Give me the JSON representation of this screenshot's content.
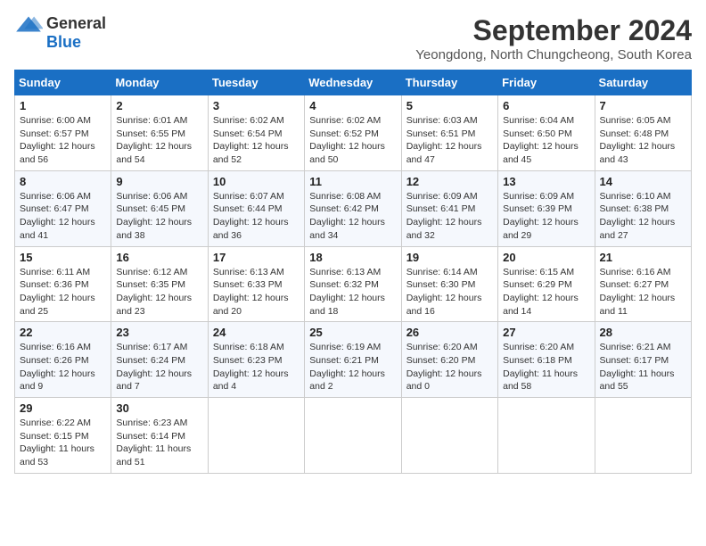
{
  "logo": {
    "general": "General",
    "blue": "Blue"
  },
  "title": "September 2024",
  "location": "Yeongdong, North Chungcheong, South Korea",
  "days_of_week": [
    "Sunday",
    "Monday",
    "Tuesday",
    "Wednesday",
    "Thursday",
    "Friday",
    "Saturday"
  ],
  "weeks": [
    [
      {
        "day": "1",
        "sunrise": "6:00 AM",
        "sunset": "6:57 PM",
        "daylight": "12 hours and 56 minutes."
      },
      {
        "day": "2",
        "sunrise": "6:01 AM",
        "sunset": "6:55 PM",
        "daylight": "12 hours and 54 minutes."
      },
      {
        "day": "3",
        "sunrise": "6:02 AM",
        "sunset": "6:54 PM",
        "daylight": "12 hours and 52 minutes."
      },
      {
        "day": "4",
        "sunrise": "6:02 AM",
        "sunset": "6:52 PM",
        "daylight": "12 hours and 50 minutes."
      },
      {
        "day": "5",
        "sunrise": "6:03 AM",
        "sunset": "6:51 PM",
        "daylight": "12 hours and 47 minutes."
      },
      {
        "day": "6",
        "sunrise": "6:04 AM",
        "sunset": "6:50 PM",
        "daylight": "12 hours and 45 minutes."
      },
      {
        "day": "7",
        "sunrise": "6:05 AM",
        "sunset": "6:48 PM",
        "daylight": "12 hours and 43 minutes."
      }
    ],
    [
      {
        "day": "8",
        "sunrise": "6:06 AM",
        "sunset": "6:47 PM",
        "daylight": "12 hours and 41 minutes."
      },
      {
        "day": "9",
        "sunrise": "6:06 AM",
        "sunset": "6:45 PM",
        "daylight": "12 hours and 38 minutes."
      },
      {
        "day": "10",
        "sunrise": "6:07 AM",
        "sunset": "6:44 PM",
        "daylight": "12 hours and 36 minutes."
      },
      {
        "day": "11",
        "sunrise": "6:08 AM",
        "sunset": "6:42 PM",
        "daylight": "12 hours and 34 minutes."
      },
      {
        "day": "12",
        "sunrise": "6:09 AM",
        "sunset": "6:41 PM",
        "daylight": "12 hours and 32 minutes."
      },
      {
        "day": "13",
        "sunrise": "6:09 AM",
        "sunset": "6:39 PM",
        "daylight": "12 hours and 29 minutes."
      },
      {
        "day": "14",
        "sunrise": "6:10 AM",
        "sunset": "6:38 PM",
        "daylight": "12 hours and 27 minutes."
      }
    ],
    [
      {
        "day": "15",
        "sunrise": "6:11 AM",
        "sunset": "6:36 PM",
        "daylight": "12 hours and 25 minutes."
      },
      {
        "day": "16",
        "sunrise": "6:12 AM",
        "sunset": "6:35 PM",
        "daylight": "12 hours and 23 minutes."
      },
      {
        "day": "17",
        "sunrise": "6:13 AM",
        "sunset": "6:33 PM",
        "daylight": "12 hours and 20 minutes."
      },
      {
        "day": "18",
        "sunrise": "6:13 AM",
        "sunset": "6:32 PM",
        "daylight": "12 hours and 18 minutes."
      },
      {
        "day": "19",
        "sunrise": "6:14 AM",
        "sunset": "6:30 PM",
        "daylight": "12 hours and 16 minutes."
      },
      {
        "day": "20",
        "sunrise": "6:15 AM",
        "sunset": "6:29 PM",
        "daylight": "12 hours and 14 minutes."
      },
      {
        "day": "21",
        "sunrise": "6:16 AM",
        "sunset": "6:27 PM",
        "daylight": "12 hours and 11 minutes."
      }
    ],
    [
      {
        "day": "22",
        "sunrise": "6:16 AM",
        "sunset": "6:26 PM",
        "daylight": "12 hours and 9 minutes."
      },
      {
        "day": "23",
        "sunrise": "6:17 AM",
        "sunset": "6:24 PM",
        "daylight": "12 hours and 7 minutes."
      },
      {
        "day": "24",
        "sunrise": "6:18 AM",
        "sunset": "6:23 PM",
        "daylight": "12 hours and 4 minutes."
      },
      {
        "day": "25",
        "sunrise": "6:19 AM",
        "sunset": "6:21 PM",
        "daylight": "12 hours and 2 minutes."
      },
      {
        "day": "26",
        "sunrise": "6:20 AM",
        "sunset": "6:20 PM",
        "daylight": "12 hours and 0 minutes."
      },
      {
        "day": "27",
        "sunrise": "6:20 AM",
        "sunset": "6:18 PM",
        "daylight": "11 hours and 58 minutes."
      },
      {
        "day": "28",
        "sunrise": "6:21 AM",
        "sunset": "6:17 PM",
        "daylight": "11 hours and 55 minutes."
      }
    ],
    [
      {
        "day": "29",
        "sunrise": "6:22 AM",
        "sunset": "6:15 PM",
        "daylight": "11 hours and 53 minutes."
      },
      {
        "day": "30",
        "sunrise": "6:23 AM",
        "sunset": "6:14 PM",
        "daylight": "11 hours and 51 minutes."
      },
      null,
      null,
      null,
      null,
      null
    ]
  ],
  "labels": {
    "sunrise": "Sunrise:",
    "sunset": "Sunset:",
    "daylight": "Daylight:"
  }
}
